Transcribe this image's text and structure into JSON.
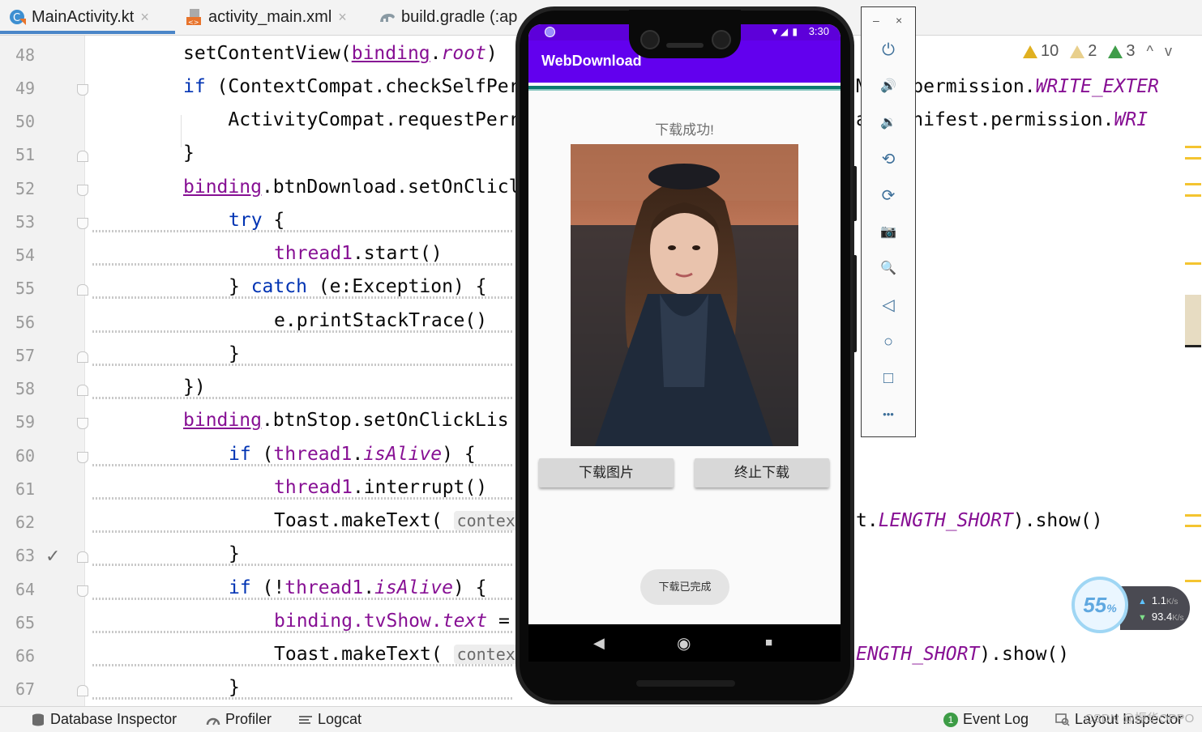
{
  "tabs": [
    {
      "label": "MainActivity.kt",
      "active": true
    },
    {
      "label": "activity_main.xml",
      "active": false
    },
    {
      "label": "build.gradle (:ap",
      "active": false
    }
  ],
  "tab_close_glyph": "×",
  "line_numbers": [
    "48",
    "49",
    "50",
    "51",
    "52",
    "53",
    "54",
    "55",
    "56",
    "57",
    "58",
    "59",
    "60",
    "61",
    "62",
    "63",
    "64",
    "65",
    "66",
    "67"
  ],
  "code": {
    "l48": {
      "a": "setContentView(",
      "b": "binding",
      "c": ".",
      "d": "root",
      "e": ")"
    },
    "l49": {
      "a": "if",
      "b": " (ContextCompat.checkSelfPer"
    },
    "l49r": {
      "a": "M",
      "b": "est.permission.",
      "c": "WRITE_EXTER"
    },
    "l50": {
      "a": "    ActivityCompat.requestPerr"
    },
    "l50r": {
      "a": "a",
      "b": "d.Manifest.permission.",
      "c": "WRI"
    },
    "l51": {
      "a": "}"
    },
    "l52": {
      "a": "binding",
      "b": ".btnDownload.setOnClicl"
    },
    "l53": {
      "a": "try",
      "b": " {"
    },
    "l54": {
      "a": "thread1",
      "b": ".start()"
    },
    "l55": {
      "a": "} ",
      "b": "catch",
      "c": " (e:Exception) {"
    },
    "l56": {
      "a": "e.printStackTrace()"
    },
    "l57": {
      "a": "}"
    },
    "l58": {
      "a": "})"
    },
    "l59": {
      "a": "binding",
      "b": ".btnStop.setOnClickLis"
    },
    "l60": {
      "a": "if",
      "b": " (",
      "c": "thread1",
      "d": ".",
      "e": "isAlive",
      "f": ") {"
    },
    "l61": {
      "a": "thread1",
      "b": ".interrupt()"
    },
    "l62": {
      "a": "Toast.makeText( ",
      "hint": "context:"
    },
    "l62r": {
      "a": "t.",
      "b": "LENGTH_SHORT",
      "c": ").show()"
    },
    "l63": {
      "a": "}"
    },
    "l64": {
      "a": "if",
      "b": " (!",
      "c": "thread1",
      "d": ".",
      "e": "isAlive",
      "f": ") {"
    },
    "l65": {
      "a": "binding",
      "b": ".tvShow.",
      "c": "text",
      "d": " ="
    },
    "l66": {
      "a": "Toast.makeText( ",
      "hint": "context:"
    },
    "l66r": {
      "a": "ENGTH_SHORT",
      "b": ").show()"
    },
    "l67": {
      "a": "}"
    }
  },
  "gutter_check_glyph": "✓",
  "inspections": {
    "warnings": "10",
    "weak_warnings": "2",
    "typos": "3",
    "up": "^",
    "down": "v"
  },
  "phone": {
    "status_time": "3:30",
    "status_icons": "▼◢ ▮",
    "app_title": "WebDownload",
    "result_text": "下载成功!",
    "btn_download": "下载图片",
    "btn_stop": "终止下载",
    "toast": "下载已完成",
    "nav_back": "◀",
    "nav_home": "◉",
    "nav_recent": "■"
  },
  "emulator_toolbar": {
    "minimize": "–",
    "close": "×",
    "icons": [
      "power-icon",
      "volume-up-icon",
      "volume-down-icon",
      "rotate-left-icon",
      "rotate-right-icon",
      "camera-icon",
      "zoom-icon",
      "back-icon",
      "home-icon",
      "overview-icon",
      "more-icon"
    ],
    "glyphs": [
      "⏻",
      "🔊",
      "🔉",
      "⟲",
      "⟳",
      "📷",
      "🔍",
      "◁",
      "○",
      "□",
      "•••"
    ]
  },
  "network": {
    "percent": "55",
    "percent_sign": "%",
    "up": "1.1",
    "up_unit": "K/s",
    "down": "93.4",
    "down_unit": "K/s"
  },
  "bottom_bar": {
    "database_inspector": "Database Inspector",
    "profiler": "Profiler",
    "logcat": "Logcat",
    "event_log": "Event Log",
    "event_log_count": "1",
    "layout_inspector": "Layout Inspector"
  },
  "watermark": "CSDN @振华OPPO",
  "colors": {
    "keyword": "#0033b3",
    "property": "#871094",
    "app_bar": "#6200ee",
    "status_bar": "#5d00d9",
    "tab_underline": "#4a86c8",
    "warning": "#e0b020"
  }
}
